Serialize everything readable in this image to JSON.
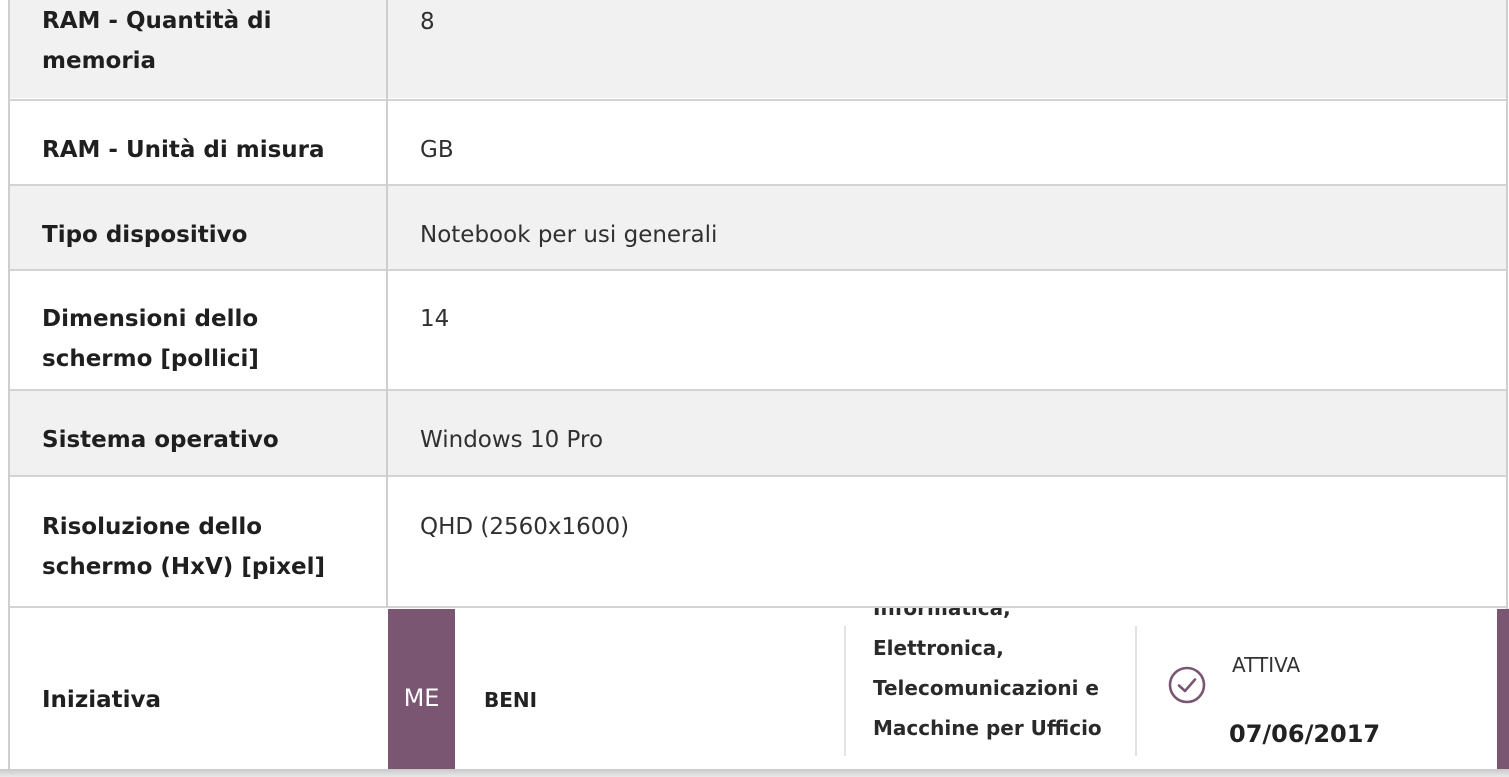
{
  "specs": [
    {
      "label": "RAM - Quantità di memoria",
      "value": "8"
    },
    {
      "label": "RAM - Unità di misura",
      "value": "GB"
    },
    {
      "label": "Tipo dispositivo",
      "value": "Notebook per usi generali"
    },
    {
      "label": "Dimensioni dello schermo [pollici]",
      "value": "14"
    },
    {
      "label": "Sistema operativo",
      "value": "Windows 10 Pro"
    },
    {
      "label": "Risoluzione dello schermo (HxV) [pixel]",
      "value": "QHD (2560x1600)"
    }
  ],
  "initiative": {
    "label": "Iniziativa",
    "badge": "ME",
    "type": "BENI",
    "category": "Informatica, Elettronica, Telecomunicazioni e Macchine per Ufficio",
    "status": "ATTIVA",
    "date": "07/06/2017",
    "accent_color": "#7a5672",
    "status_icon": "check-circle-icon"
  }
}
